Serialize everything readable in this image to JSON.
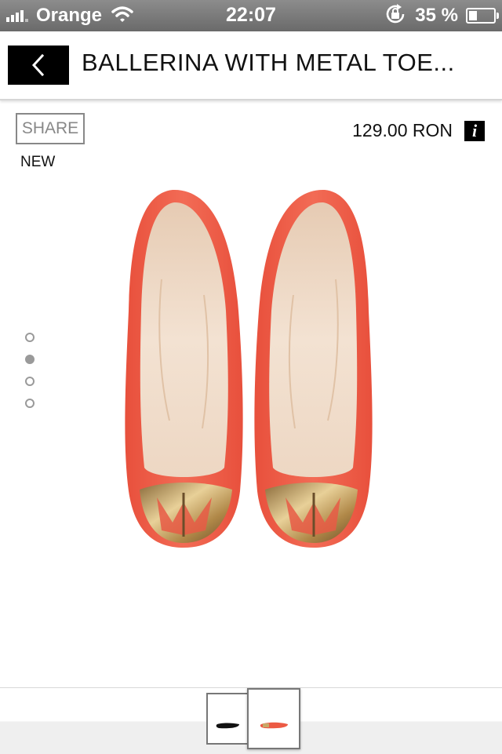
{
  "status_bar": {
    "carrier": "Orange",
    "time": "22:07",
    "battery_percent": "35 %",
    "battery_level": 0.35
  },
  "header": {
    "title": "BALLERINA WITH METAL TOE..."
  },
  "product": {
    "share_label": "SHARE",
    "badge": "NEW",
    "price": "129.00 RON",
    "info_label": "i"
  },
  "gallery": {
    "page_count": 4,
    "active_page": 2
  },
  "colors": {
    "shoe_suede": "#f0624d",
    "shoe_lining": "#f0dcc8",
    "metal_toe": "#c8a868"
  },
  "icons": {
    "back": "chevron-left-icon",
    "info": "info-icon",
    "wifi": "wifi-icon",
    "rotation_lock": "rotation-lock-icon"
  }
}
